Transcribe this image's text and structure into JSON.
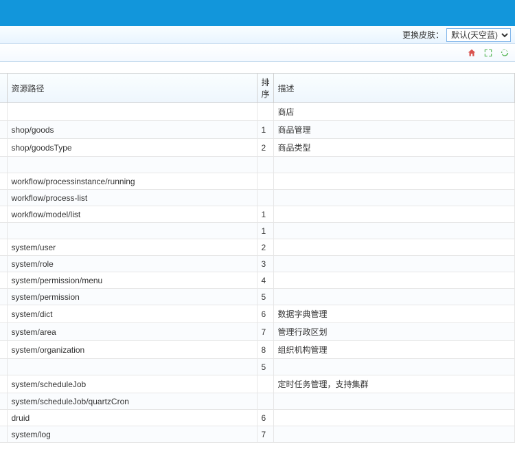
{
  "skinBar": {
    "label": "更换皮肤：",
    "selected": "默认(天空蓝)",
    "options": [
      "默认(天空蓝)"
    ]
  },
  "table": {
    "headers": {
      "path": "资源路径",
      "order": "排序",
      "desc": "描述"
    },
    "rows": [
      {
        "path": "",
        "order": "",
        "desc": "商店"
      },
      {
        "path": "shop/goods",
        "order": "1",
        "desc": "商品管理"
      },
      {
        "path": "shop/goodsType",
        "order": "2",
        "desc": "商品类型"
      },
      {
        "path": "",
        "order": "",
        "desc": ""
      },
      {
        "path": "workflow/processinstance/running",
        "order": "",
        "desc": ""
      },
      {
        "path": "workflow/process-list",
        "order": "",
        "desc": ""
      },
      {
        "path": "workflow/model/list",
        "order": "1",
        "desc": ""
      },
      {
        "path": "",
        "order": "1",
        "desc": ""
      },
      {
        "path": "system/user",
        "order": "2",
        "desc": ""
      },
      {
        "path": "system/role",
        "order": "3",
        "desc": ""
      },
      {
        "path": "system/permission/menu",
        "order": "4",
        "desc": ""
      },
      {
        "path": "system/permission",
        "order": "5",
        "desc": ""
      },
      {
        "path": "system/dict",
        "order": "6",
        "desc": "数据字典管理"
      },
      {
        "path": "system/area",
        "order": "7",
        "desc": "管理行政区划"
      },
      {
        "path": "system/organization",
        "order": "8",
        "desc": "组织机构管理"
      },
      {
        "path": "",
        "order": "5",
        "desc": ""
      },
      {
        "path": "system/scheduleJob",
        "order": "",
        "desc": "定时任务管理，支持集群"
      },
      {
        "path": "system/scheduleJob/quartzCron",
        "order": "",
        "desc": ""
      },
      {
        "path": "druid",
        "order": "6",
        "desc": ""
      },
      {
        "path": "system/log",
        "order": "7",
        "desc": ""
      }
    ]
  }
}
